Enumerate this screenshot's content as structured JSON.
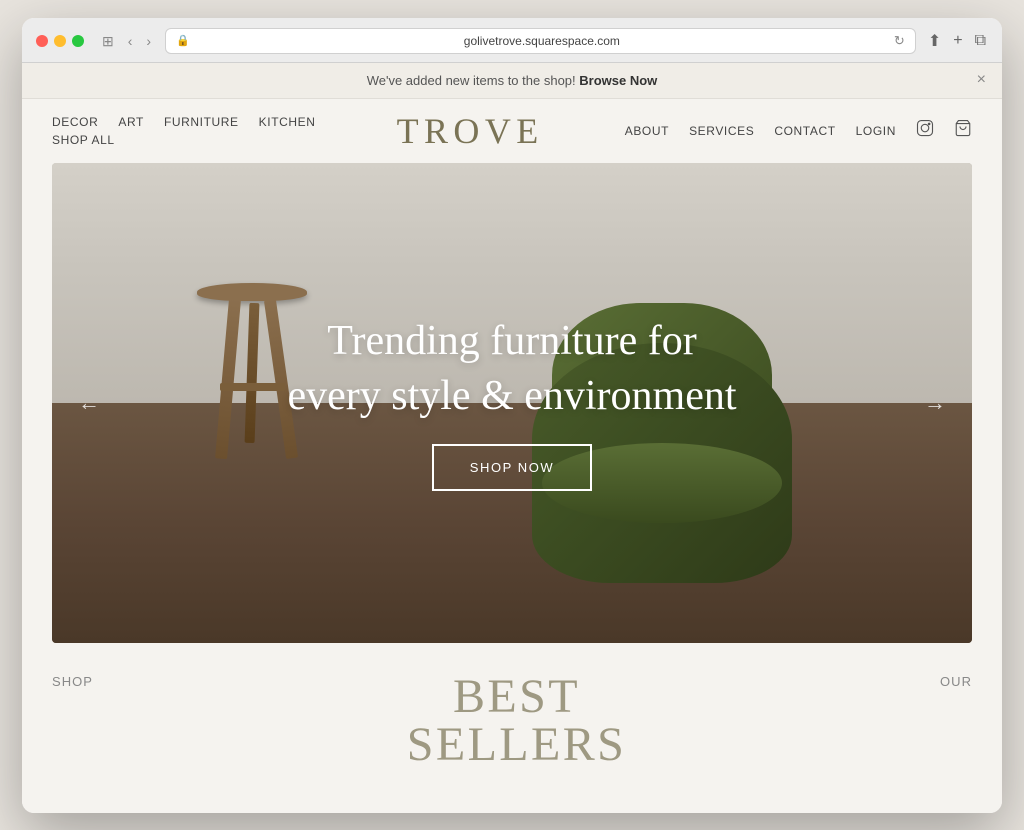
{
  "browser": {
    "url": "golivetrove.squarespace.com",
    "back_label": "‹",
    "forward_label": "›",
    "sidebar_label": "⊞",
    "share_label": "⬆",
    "new_tab_label": "+",
    "duplicate_label": "⧉",
    "refresh_label": "↻",
    "lock_label": "🔒"
  },
  "announcement": {
    "text": "We've added new items to the shop! ",
    "link_text": "Browse Now",
    "close_label": "×"
  },
  "nav": {
    "left_items": [
      "DECOR",
      "ART",
      "FURNITURE",
      "KITCHEN"
    ],
    "left_items_row2": [
      "SHOP ALL"
    ],
    "brand": "TROVE",
    "right_items": [
      "ABOUT",
      "SERVICES",
      "CONTACT",
      "LOGIN"
    ],
    "instagram_label": "instagram-icon",
    "cart_label": "cart-icon"
  },
  "hero": {
    "tagline_line1": "Trending furniture for",
    "tagline_line2": "every style & environment",
    "cta_label": "SHOP NOW",
    "arrow_left": "←",
    "arrow_right": "→"
  },
  "bottom": {
    "left_label": "SHOP",
    "center_title": "BEST",
    "center_subtitle": "SELLERS",
    "right_label": "OUR"
  },
  "colors": {
    "brand_gold": "#7a7355",
    "bg_light": "#f5f3ef",
    "announcement_bg": "#f0ede7",
    "hero_chair_green": "#4a5c2a",
    "hero_stool_brown": "#8b6f4e",
    "text_dark": "#333",
    "text_mid": "#555",
    "text_light": "#888"
  }
}
